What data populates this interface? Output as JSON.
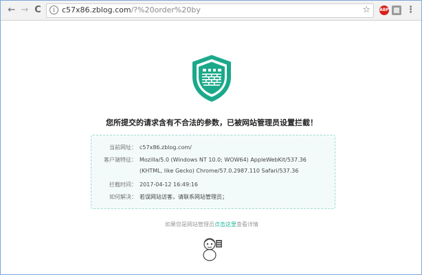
{
  "browser": {
    "back": "←",
    "forward": "→",
    "reload": "C",
    "url_host": "c57x86.zblog.com",
    "url_path": "/?%20order%20by",
    "star": "☆",
    "abp": "ABP",
    "menu": "⋮"
  },
  "page": {
    "headline": "您所提交的请求含有不合法的参数，已被网站管理员设置拦截！",
    "rows": [
      {
        "label": "当前网址：",
        "value": "c57x86.zblog.com/"
      },
      {
        "label": "客户端特征：",
        "value": "Mozilla/5.0 (Windows NT 10.0; WOW64) AppleWebKit/537.36 (KHTML, like Gecko) Chrome/57.0.2987.110 Safari/537.36"
      },
      {
        "label": "拦截时间：",
        "value": "2017-04-12 16:49:16"
      },
      {
        "label": "如何解决：",
        "value": "若误网站访客，请联系网站管理员；"
      }
    ],
    "footer_prefix": "如果您是网站管理员",
    "footer_link": "点击这里",
    "footer_suffix": "查看详情",
    "colors": {
      "accent": "#1fb69a",
      "shield": "#1ba98a"
    }
  }
}
